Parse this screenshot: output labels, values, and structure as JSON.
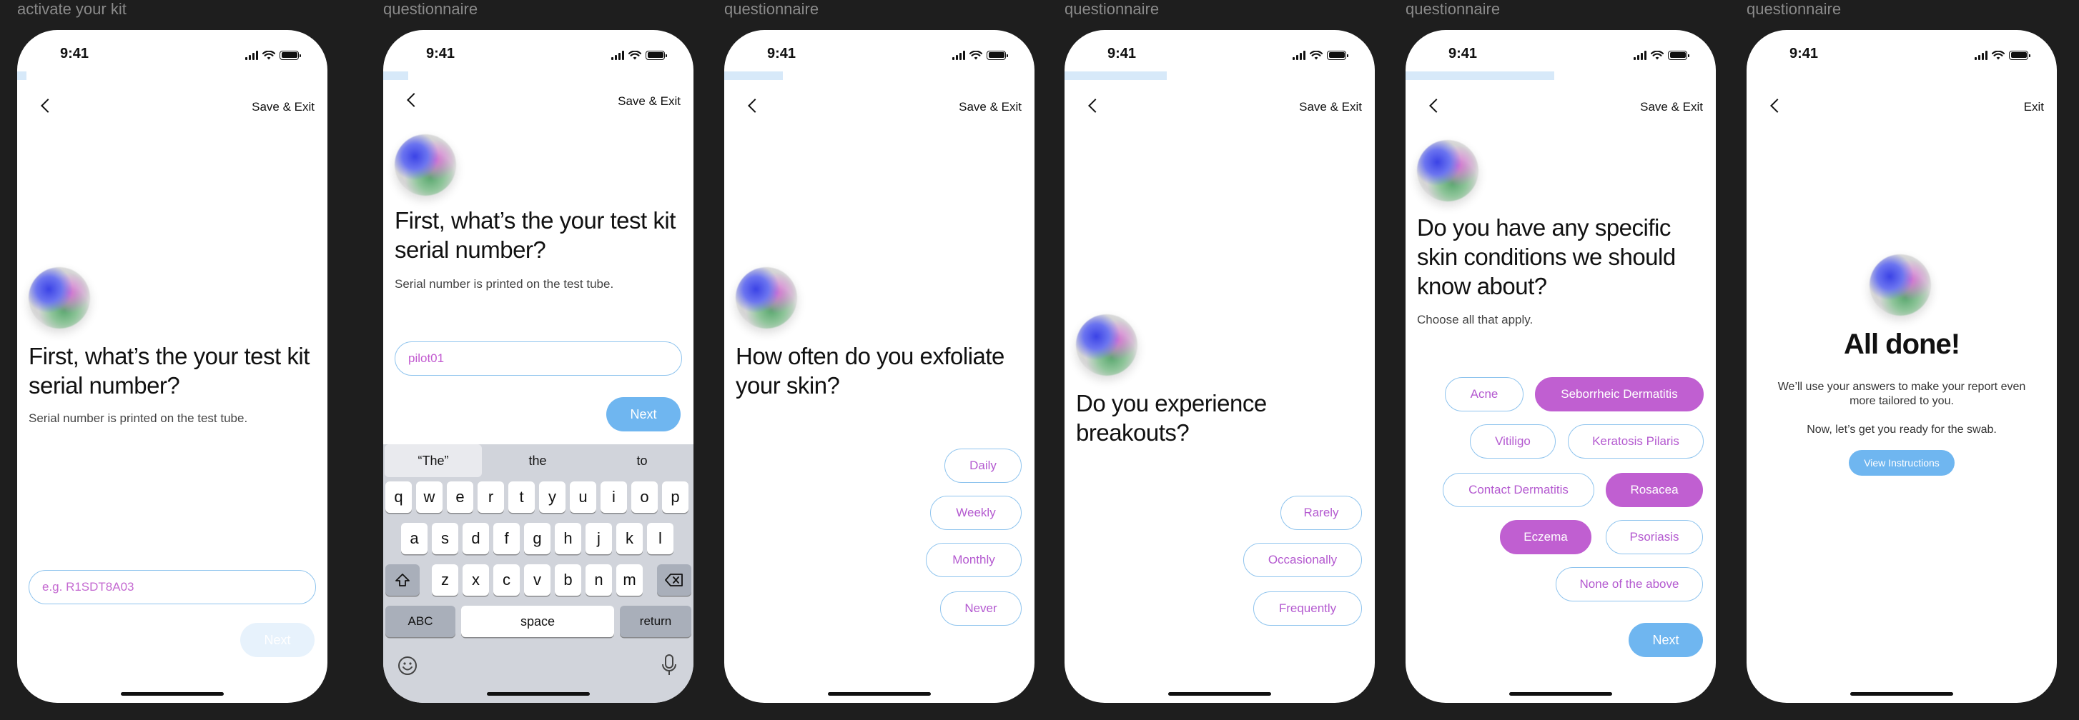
{
  "frames": [
    {
      "label": "activate your kit",
      "time": "9:41",
      "top_link": "Save & Exit",
      "title": "First, what’s the your test kit serial number?",
      "subtitle": "Serial number is printed on the test tube.",
      "input_placeholder": "e.g. R1SDT8A03",
      "next_label": "Next",
      "progress": 0.03
    },
    {
      "label": "questionnaire",
      "time": "9:41",
      "top_link": "Save & Exit",
      "title": "First, what’s the your test kit serial number?",
      "subtitle": "Serial number is printed on the test tube.",
      "input_value": "pilot01",
      "next_label": "Next",
      "progress": 0.08,
      "keyboard": {
        "suggestions": [
          "“The”",
          "the",
          "to"
        ],
        "row1": [
          "q",
          "w",
          "e",
          "r",
          "t",
          "y",
          "u",
          "i",
          "o",
          "p"
        ],
        "row2": [
          "a",
          "s",
          "d",
          "f",
          "g",
          "h",
          "j",
          "k",
          "l"
        ],
        "row3": [
          "z",
          "x",
          "c",
          "v",
          "b",
          "n",
          "m"
        ],
        "abc": "ABC",
        "space": "space",
        "return": "return"
      }
    },
    {
      "label": "questionnaire",
      "time": "9:41",
      "top_link": "Save & Exit",
      "title": "How often do you exfoliate your skin?",
      "options": [
        "Daily",
        "Weekly",
        "Monthly",
        "Never"
      ],
      "progress": 0.19
    },
    {
      "label": "questionnaire",
      "time": "9:41",
      "top_link": "Save & Exit",
      "title": "Do you experience breakouts?",
      "options": [
        "Rarely",
        "Occasionally",
        "Frequently"
      ],
      "progress": 0.33
    },
    {
      "label": "questionnaire",
      "time": "9:41",
      "top_link": "Save & Exit",
      "title": "Do you have any specific skin conditions we should know about?",
      "subtitle": "Choose all that apply.",
      "options": [
        {
          "label": "Acne",
          "selected": false
        },
        {
          "label": "Seborrheic Dermatitis",
          "selected": true
        },
        {
          "label": "Vitiligo",
          "selected": false
        },
        {
          "label": "Keratosis Pilaris",
          "selected": false
        },
        {
          "label": "Contact Dermatitis",
          "selected": false
        },
        {
          "label": "Rosacea",
          "selected": true
        },
        {
          "label": "Eczema",
          "selected": true
        },
        {
          "label": "Psoriasis",
          "selected": false
        },
        {
          "label": "None of the above",
          "selected": false
        }
      ],
      "next_label": "Next",
      "progress": 0.48
    },
    {
      "label": "questionnaire",
      "time": "9:41",
      "top_link": "Exit",
      "title": "All done!",
      "text1": "We’ll use your answers to make your report even more tailored to you.",
      "text2": "Now, let’s get you ready for the swab.",
      "button_label": "View Instructions"
    }
  ],
  "colors": {
    "canvas": "#1e1e1e",
    "accent_blue": "#6fb6f0",
    "accent_purple": "#c05fd1",
    "chip_border": "#8fc4ee",
    "progress_fill": "#d7e9f9"
  }
}
